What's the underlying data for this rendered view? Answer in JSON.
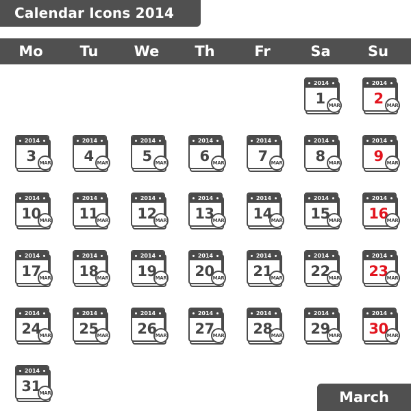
{
  "title": "Calendar Icons 2014",
  "weekdays": [
    "Mo",
    "Tu",
    "We",
    "Th",
    "Fr",
    "Sa",
    "Su"
  ],
  "month_label": "March",
  "icon_year": "2014",
  "icon_month_abbr": "MAR",
  "colors": {
    "bar": "#505050",
    "icon": "#4a4a4a",
    "sunday_number": "#e2141e",
    "number": "#444444"
  },
  "first_weekday_index": 5,
  "days": [
    {
      "day": "1",
      "weekday": "Sa",
      "sunday": false
    },
    {
      "day": "2",
      "weekday": "Su",
      "sunday": true
    },
    {
      "day": "3",
      "weekday": "Mo",
      "sunday": false
    },
    {
      "day": "4",
      "weekday": "Tu",
      "sunday": false
    },
    {
      "day": "5",
      "weekday": "We",
      "sunday": false
    },
    {
      "day": "6",
      "weekday": "Th",
      "sunday": false
    },
    {
      "day": "7",
      "weekday": "Fr",
      "sunday": false
    },
    {
      "day": "8",
      "weekday": "Sa",
      "sunday": false
    },
    {
      "day": "9",
      "weekday": "Su",
      "sunday": true
    },
    {
      "day": "10",
      "weekday": "Mo",
      "sunday": false
    },
    {
      "day": "11",
      "weekday": "Tu",
      "sunday": false
    },
    {
      "day": "12",
      "weekday": "We",
      "sunday": false
    },
    {
      "day": "13",
      "weekday": "Th",
      "sunday": false
    },
    {
      "day": "14",
      "weekday": "Fr",
      "sunday": false
    },
    {
      "day": "15",
      "weekday": "Sa",
      "sunday": false
    },
    {
      "day": "16",
      "weekday": "Su",
      "sunday": true
    },
    {
      "day": "17",
      "weekday": "Mo",
      "sunday": false
    },
    {
      "day": "18",
      "weekday": "Tu",
      "sunday": false
    },
    {
      "day": "19",
      "weekday": "We",
      "sunday": false
    },
    {
      "day": "20",
      "weekday": "Th",
      "sunday": false
    },
    {
      "day": "21",
      "weekday": "Fr",
      "sunday": false
    },
    {
      "day": "22",
      "weekday": "Sa",
      "sunday": false
    },
    {
      "day": "23",
      "weekday": "Su",
      "sunday": true
    },
    {
      "day": "24",
      "weekday": "Mo",
      "sunday": false
    },
    {
      "day": "25",
      "weekday": "Tu",
      "sunday": false
    },
    {
      "day": "26",
      "weekday": "We",
      "sunday": false
    },
    {
      "day": "27",
      "weekday": "Th",
      "sunday": false
    },
    {
      "day": "28",
      "weekday": "Fr",
      "sunday": false
    },
    {
      "day": "29",
      "weekday": "Sa",
      "sunday": false
    },
    {
      "day": "30",
      "weekday": "Su",
      "sunday": true
    },
    {
      "day": "31",
      "weekday": "Mo",
      "sunday": false
    }
  ]
}
